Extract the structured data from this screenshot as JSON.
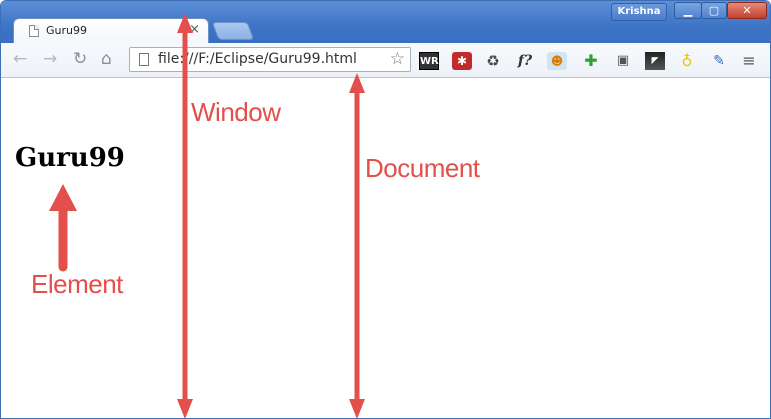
{
  "browser": {
    "tab_title": "Guru99",
    "tab_close": "×",
    "user_name": "Krishna",
    "window_buttons": {
      "minimize": "▁",
      "maximize": "▢",
      "close": "✕"
    }
  },
  "toolbar": {
    "back": "←",
    "forward": "→",
    "reload": "↻",
    "home": "⌂",
    "address": "file:///F:/Eclipse/Guru99.html",
    "star": "☆",
    "extensions": {
      "webrank": "WR",
      "lastpass": "✱",
      "recycle": "♻",
      "f": "f?",
      "fox": "☻",
      "plus": "✚",
      "chat": "▣",
      "flag": "◤",
      "bulb": "♁",
      "dropper": "✎",
      "menu": "≡"
    }
  },
  "content": {
    "heading": "Guru99"
  },
  "annotations": {
    "window": "Window",
    "document": "Document",
    "element": "Element",
    "color": "#e34f4b"
  }
}
